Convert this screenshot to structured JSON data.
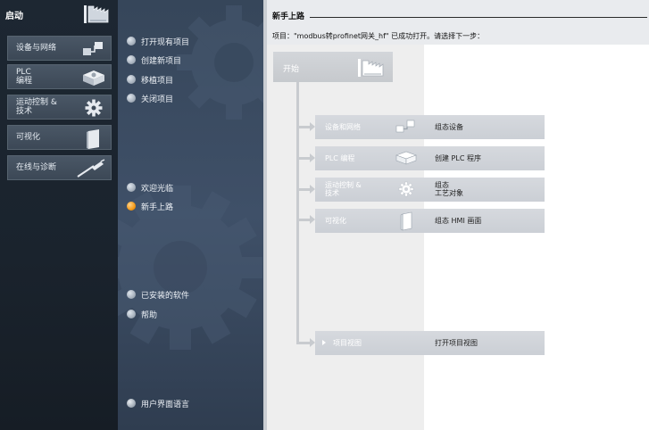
{
  "portal": {
    "title": "启动",
    "buttons": [
      {
        "label": "设备与网络",
        "icon": "devices-network-icon"
      },
      {
        "label": "PLC\n编程",
        "icon": "plc-programming-icon"
      },
      {
        "label": "运动控制 &\n技术",
        "icon": "gear-icon"
      },
      {
        "label": "可视化",
        "icon": "hmi-screen-icon"
      },
      {
        "label": "在线与诊断",
        "icon": "diagnostics-probe-icon"
      }
    ]
  },
  "actions": {
    "items": [
      {
        "label": "打开现有项目",
        "active": false
      },
      {
        "label": "创建新项目",
        "active": false
      },
      {
        "label": "移植项目",
        "active": false
      },
      {
        "label": "关闭项目",
        "active": false
      },
      {
        "label": "欢迎光临",
        "active": false
      },
      {
        "label": "新手上路",
        "active": true
      },
      {
        "label": "已安装的软件",
        "active": false
      },
      {
        "label": "帮助",
        "active": false
      },
      {
        "label": "用户界面语言",
        "active": false,
        "icon": "globe-icon"
      }
    ]
  },
  "content": {
    "title": "新手上路",
    "status": "项目：\"modbus转profinet网关_hf\" 已成功打开。请选择下一步：",
    "start_label": "开始",
    "steps": [
      {
        "label": "设备和网络",
        "icon": "devices-network-icon",
        "action": "组态设备"
      },
      {
        "label": "PLC 编程",
        "icon": "plc-programming-icon",
        "action": "创建 PLC 程序"
      },
      {
        "label": "运动控制 &\n技术",
        "icon": "gear-icon",
        "action": "组态\n工艺对象"
      },
      {
        "label": "可视化",
        "icon": "hmi-screen-icon",
        "action": "组态 HMI 画面"
      },
      {
        "label": "项目视图",
        "icon": "arrow-icon",
        "action": "打开项目视图"
      }
    ]
  },
  "colors": {
    "left_panel": "#1d2732",
    "mid_panel": "#3f5068",
    "active_dot": "#f59a16",
    "step_button": "#d3d6dc"
  }
}
